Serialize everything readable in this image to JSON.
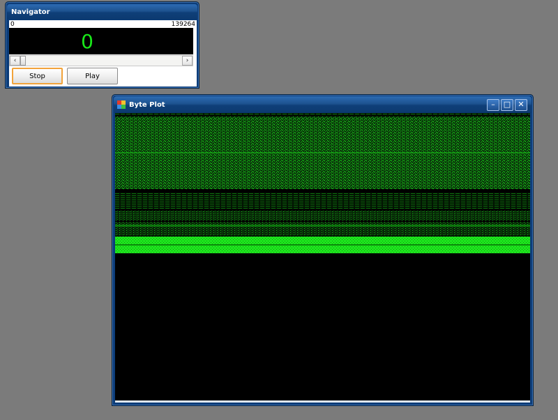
{
  "navigator": {
    "title": "Navigator",
    "range_min": "0",
    "range_max": "139264",
    "current_value": "0",
    "position_fraction": 0,
    "scroll_left_icon": "chevron-left-icon",
    "scroll_right_icon": "chevron-right-icon",
    "stop_label": "Stop",
    "play_label": "Play"
  },
  "byteplot": {
    "title": "Byte Plot",
    "window_icon": "app-window-icon",
    "controls": {
      "minimize_icon": "minimize-icon",
      "maximize_icon": "maximize-icon",
      "close_icon": "close-icon"
    }
  },
  "colors": {
    "desktop": "#7b7b7b",
    "titlebar": "#1d528f",
    "plot_background": "#000000",
    "plot_bright": "#19e819",
    "plot_dark": "#0a4a0a",
    "stop_focus_border": "#f2a33a"
  }
}
